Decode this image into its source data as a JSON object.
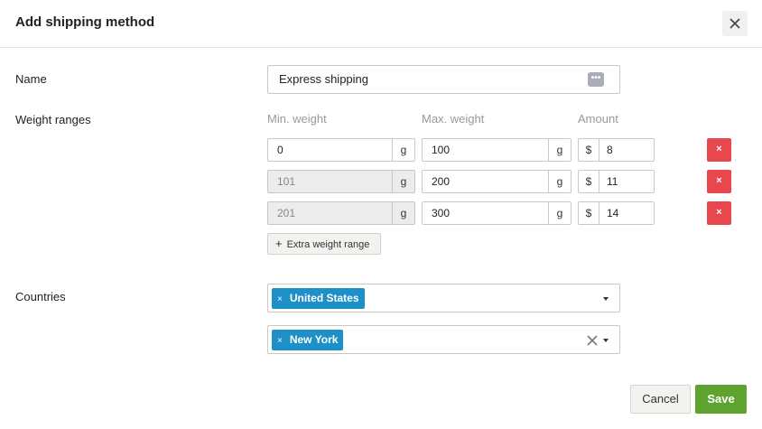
{
  "dialog": {
    "title": "Add shipping method",
    "close_icon": "close-icon"
  },
  "name_section": {
    "label": "Name",
    "value": "Express shipping",
    "options_icon": "more-options-icon"
  },
  "weights": {
    "label": "Weight ranges",
    "headers": {
      "min": "Min. weight",
      "max": "Max. weight",
      "amount": "Amount"
    },
    "unit": "g",
    "currency": "$",
    "rows": [
      {
        "min": "0",
        "max": "100",
        "amount": "8",
        "min_disabled": false,
        "delete": "×"
      },
      {
        "min": "101",
        "max": "200",
        "amount": "11",
        "min_disabled": true,
        "delete": "×"
      },
      {
        "min": "201",
        "max": "300",
        "amount": "14",
        "min_disabled": true,
        "delete": "×"
      }
    ],
    "add_button": "Extra weight range",
    "add_icon": "+"
  },
  "countries": {
    "label": "Countries",
    "country_tag": "United States",
    "region_tag": "New York",
    "tag_remove": "×"
  },
  "footer": {
    "cancel": "Cancel",
    "save": "Save"
  },
  "colors": {
    "delete": "#e8474e",
    "tag": "#1e90c8",
    "save": "#5ea22f"
  }
}
